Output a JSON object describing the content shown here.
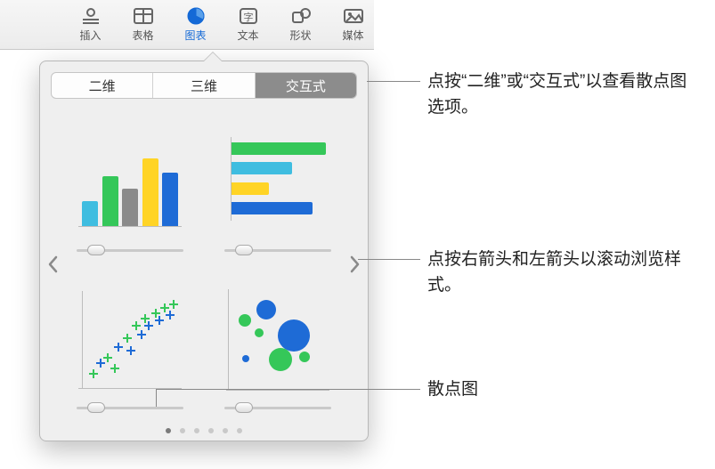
{
  "toolbar": {
    "items": [
      {
        "label": "插入"
      },
      {
        "label": "表格"
      },
      {
        "label": "图表"
      },
      {
        "label": "文本"
      },
      {
        "label": "形状"
      },
      {
        "label": "媒体"
      }
    ]
  },
  "segmented": {
    "items": [
      "二维",
      "三维",
      "交互式"
    ],
    "selected_index": 2
  },
  "page_dots": {
    "count": 6,
    "active": 0
  },
  "callouts": {
    "seg_tip": "点按“二维”或“交互式”以查看散点图选项。",
    "arrow_tip": "点按右箭头和左箭头以滚动浏览样式。",
    "scatter_label": "散点图"
  }
}
